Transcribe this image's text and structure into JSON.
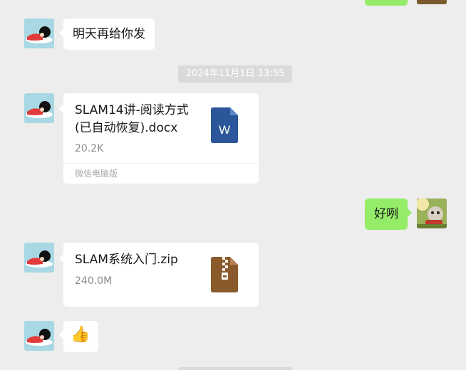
{
  "messages": {
    "text_1": "明天再给你发",
    "timestamp": "2024年11月1日 13:55",
    "file_1": {
      "name": "SLAM14讲-阅读方式(已自动恢复).docx",
      "size": "20.2K",
      "source": "微信电脑版",
      "icon": "word-document-icon"
    },
    "text_2": "好咧",
    "file_2": {
      "name": "SLAM系统入门.zip",
      "size": "240.0M",
      "icon": "zip-archive-icon"
    },
    "emoji": "👍"
  },
  "colors": {
    "background": "#ededed",
    "self_bubble": "#95ec69",
    "other_bubble": "#ffffff",
    "word_blue": "#2b579a",
    "zip_brown": "#8b5a2b"
  }
}
